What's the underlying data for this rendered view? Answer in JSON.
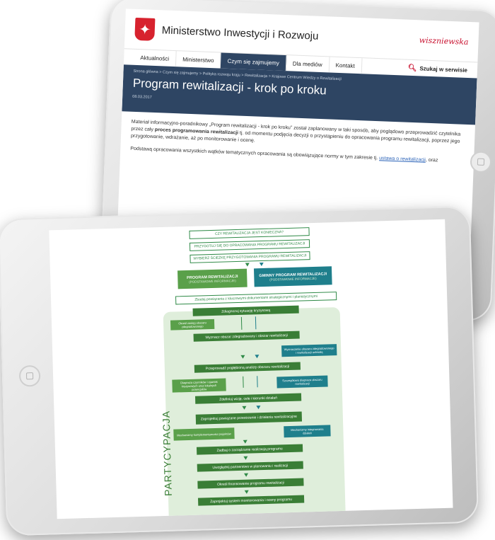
{
  "site": {
    "ministry_name": "Ministerstwo Inwestycji i Rozwoju",
    "signature": "wiszniewska"
  },
  "nav": {
    "items": [
      "Aktualności",
      "Ministerstwo",
      "Czym się zajmujemy",
      "Dla mediów",
      "Kontakt"
    ],
    "active_index": 2,
    "search_label": "Szukaj w serwisie"
  },
  "page": {
    "breadcrumb": "Strona główna > Czym się zajmujemy > Polityka rozwoju kraju > Rewitalizacja > Krajowe Centrum Wiedzy o Rewitalizacji",
    "title": "Program rewitalizacji - krok po kroku",
    "date": "08.03.2017",
    "para1_a": "Materiał informacyjno-poradnikowy „Program rewitalizacji - krok po kroku” został zaplanowany w taki sposób, aby poglądowo przeprowadzić czytelnika przez cały ",
    "para1_bold": "proces programowania rewitalizacji",
    "para1_b": " tj. od momentu podjęcia decyzji o przystąpieniu do opracowania programu rewitalizacji, poprzez jego przygotowanie, wdrażanie, aż po monitorowanie i ocenę.",
    "para2_a": "Podstawą opracowania wszystkich wątków tematycznych opracowania są obowiązujące normy w tym zakresie tj. ",
    "para2_link": "ustawa o rewitalizacji",
    "para2_b": ", oraz"
  },
  "flow": {
    "q1": "CZY REWITALIZACJA JEST KONIECZNA?",
    "q2": "PRZYGOTUJ SIĘ DO OPRACOWANIA PROGRAMU REWITALIZACJI",
    "q3": "WYBIERZ ŚCIEŻKĘ PRZYGOTOWANIA PROGRAMU REWITALIZACJI",
    "left_title": "PROGRAM REWITALIZACJI",
    "left_sub": "(PODSTAWOWE INFORMACJE)",
    "right_title": "GMINNY PROGRAM REWITALIZACJI",
    "right_sub": "(PODSTAWOWE INFORMACJE)",
    "links": "Zbadaj powiązania z kluczowymi dokumentami strategicznymi i planistycznymi",
    "s1": "Zdiagnozuj sytuację kryzysową",
    "s1_side": "Określ zasięg obszaru zdegradowanego",
    "s2": "Wyznacz obszar zdegradowany i obszar rewitalizacji",
    "s2_side": "Wyznaczenie obszaru zdegradowanego i rewitalizacji uchwałą",
    "s3": "Przeprowadź pogłębioną analizę obszaru rewitalizacji",
    "s3_side_l": "Diagnoza czynników i zjawisk kryzysowych oraz lokalnych potencjałów",
    "s3_side_r": "Szczegółowa diagnoza obszaru rewitalizacji",
    "s4": "Zdefiniuj wizję, cele i kierunki działań",
    "s5": "Zaprojektuj powiązane przestrzenie i działania rewitalizacyjne",
    "s5_side_l": "Mechanizmy komplementarności projektów",
    "s5_side_r": "Mechanizmy integrowania działań",
    "s6": "Zadbaj o zarządzanie realizacją programu",
    "s7": "Uwzględnij partnerstwo w planowaniu i realizacji",
    "s8": "Określ finansowanie programu rewitalizacji",
    "s9": "Zaprojektuj system monitorowania i oceny programu",
    "side_label": "PARTYCYPACJA"
  },
  "colors": {
    "navy": "#2e4563",
    "green": "#5aa04a",
    "dark_green": "#3a7e36",
    "teal": "#1f7f8c",
    "red": "#c8102e"
  }
}
